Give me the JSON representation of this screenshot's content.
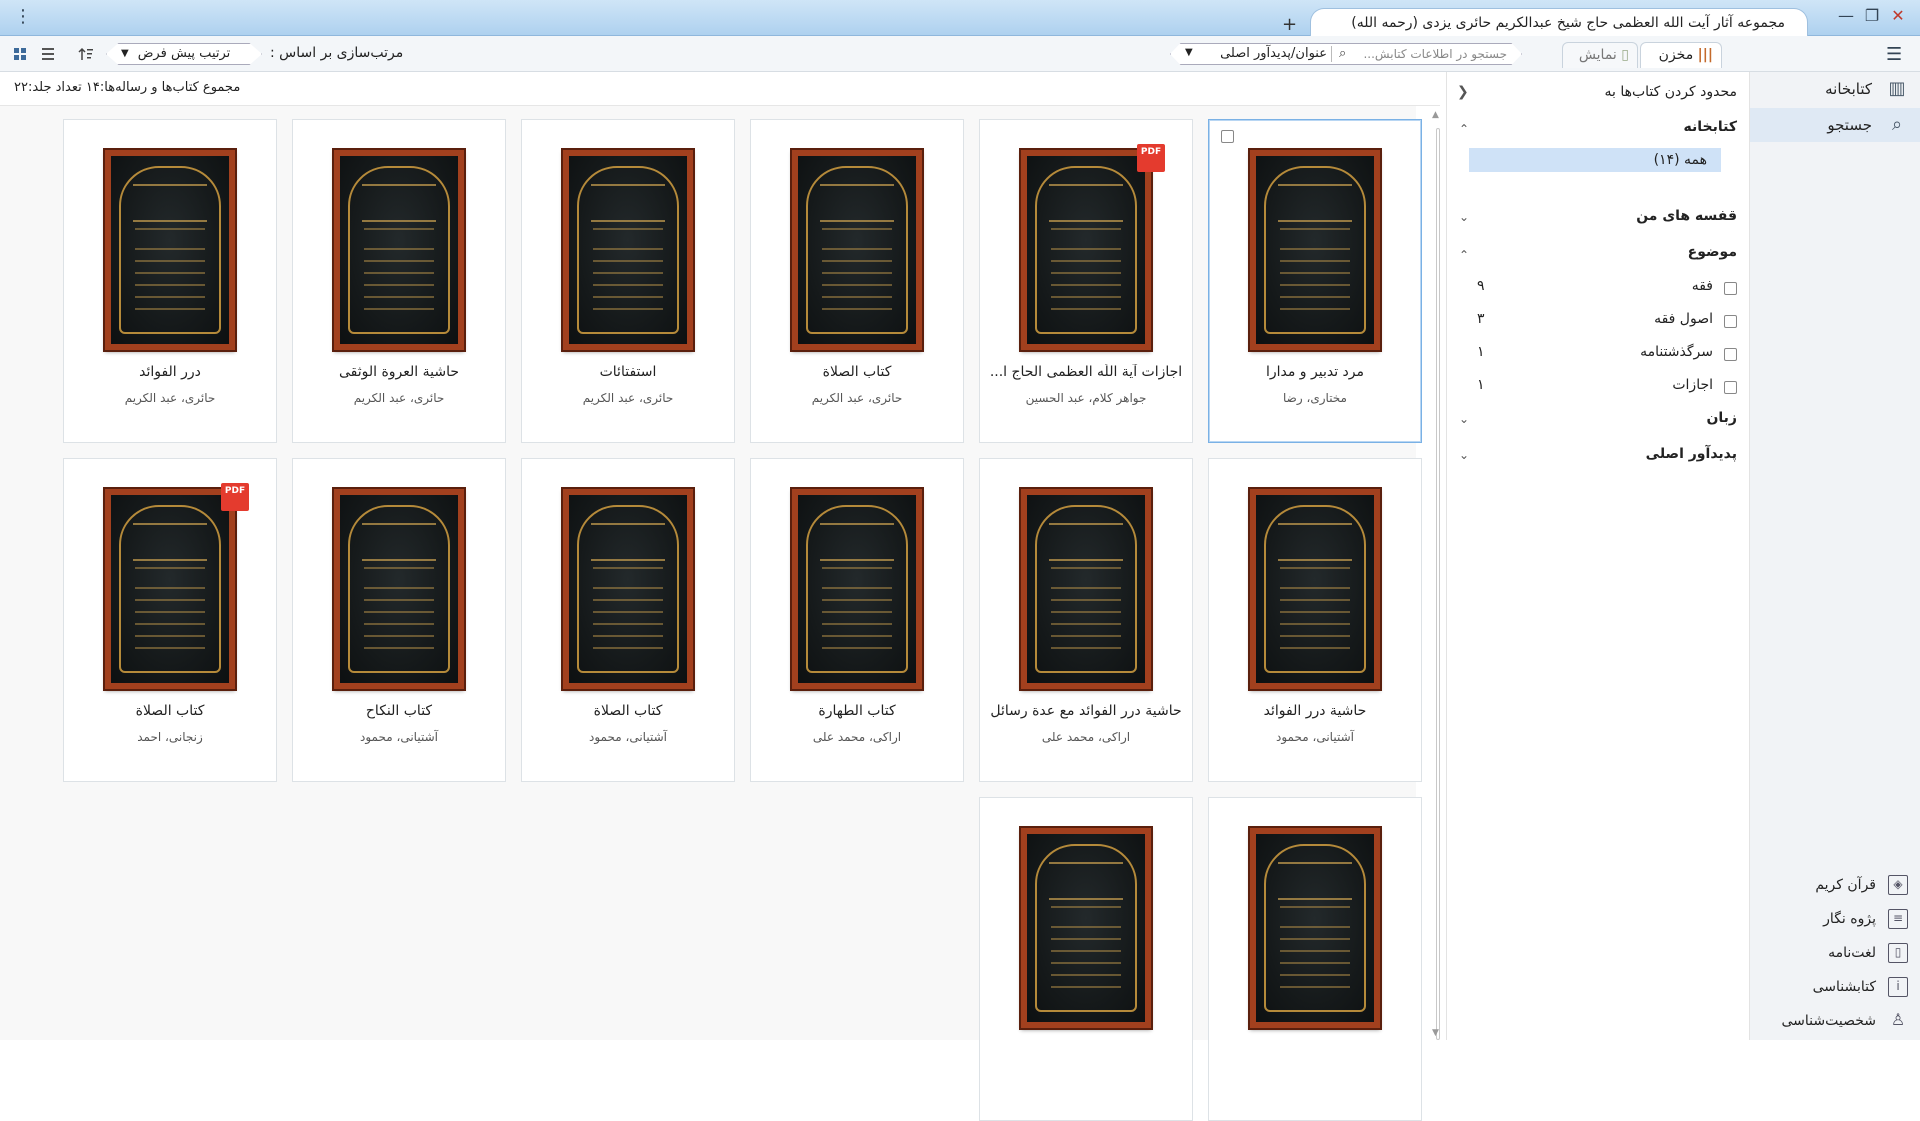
{
  "window": {
    "tab_title": "مجموعه آثار آیت الله العظمی حاج شیخ عبدالکریم حائری یزدی (رحمه الله)",
    "new_tab": "+",
    "minimize": "—",
    "restore": "❐",
    "close": "✕",
    "menu": "⋮"
  },
  "toolbar": {
    "sort_label": "مرتب‌سازی بر اساس :",
    "sort_value": "ترتیب پیش فرض",
    "search_placeholder": "جستجو در اطلاعات کتابش...",
    "search_field": "عنوان/پدیدآور اصلی",
    "view_tabs": [
      "مخزن",
      "نمایش"
    ],
    "hamburger": "☰"
  },
  "summary": {
    "text": "مجموع کتاب‌ها و رساله‌ها:۱۴   تعداد جلد:۲۲"
  },
  "books": [
    {
      "title": "مرد تدبیر و مدارا",
      "author": "مختاری، رضا",
      "pdf": false,
      "selected": true
    },
    {
      "title": "اجازات آیة اللّٰه العظمی الحاج ا...",
      "author": "جواهر کلام، عبد الحسین",
      "pdf": true,
      "selected": false
    },
    {
      "title": "کتاب الصلاة",
      "author": "حائری، عبد الکریم",
      "pdf": false,
      "selected": false
    },
    {
      "title": "استفتائات",
      "author": "حائری، عبد الکریم",
      "pdf": false,
      "selected": false
    },
    {
      "title": "حاشية العروة الوثقی",
      "author": "حائری، عبد الکریم",
      "pdf": false,
      "selected": false
    },
    {
      "title": "درر الفوائد",
      "author": "حائری، عبد الکریم",
      "pdf": false,
      "selected": false
    },
    {
      "title": "حاشية درر الفوائد",
      "author": "آشتیانی، محمود",
      "pdf": false,
      "selected": false
    },
    {
      "title": "حاشية درر الفوائد مع عدة رسائل",
      "author": "اراکی، محمد علی",
      "pdf": false,
      "selected": false
    },
    {
      "title": "کتاب الطهارة",
      "author": "اراکی، محمد علی",
      "pdf": false,
      "selected": false
    },
    {
      "title": "کتاب الصلاة",
      "author": "آشتیانی، محمود",
      "pdf": false,
      "selected": false
    },
    {
      "title": "کتاب النکاح",
      "author": "آشتیانی، محمود",
      "pdf": false,
      "selected": false
    },
    {
      "title": "کتاب الصلاة",
      "author": "زنجانی، احمد",
      "pdf": true,
      "selected": false
    },
    {
      "title": "",
      "author": "",
      "pdf": false,
      "selected": false
    },
    {
      "title": "",
      "author": "",
      "pdf": false,
      "selected": false
    }
  ],
  "filter_panel": {
    "header": "محدود کردن کتاب‌ها به",
    "library_heading": "کتابخانه",
    "all_option": "همه (۱۴)",
    "my_shelves": "قفسه های من",
    "subject_heading": "موضوع",
    "subjects": [
      {
        "label": "فقه",
        "count": "۹"
      },
      {
        "label": "اصول فقه",
        "count": "۳"
      },
      {
        "label": "سرگذشتنامه",
        "count": "۱"
      },
      {
        "label": "اجازات",
        "count": "۱"
      }
    ],
    "language_heading": "زبان",
    "author_heading": "پدیدآور اصلی"
  },
  "sidebar": {
    "top": [
      {
        "label": "کتابخانه",
        "icon": "bookshelf-icon"
      },
      {
        "label": "جستجو",
        "icon": "search-icon"
      }
    ],
    "bottom": [
      {
        "label": "قرآن کریم",
        "icon": "quran-icon"
      },
      {
        "label": "پژوه نگار",
        "icon": "notebook-icon"
      },
      {
        "label": "لغت‌نامه",
        "icon": "dictionary-icon"
      },
      {
        "label": "کتابشناسی",
        "icon": "bibliography-icon"
      },
      {
        "label": "شخصیت‌شناسی",
        "icon": "person-icon"
      }
    ]
  },
  "pdf_badge": "PDF"
}
